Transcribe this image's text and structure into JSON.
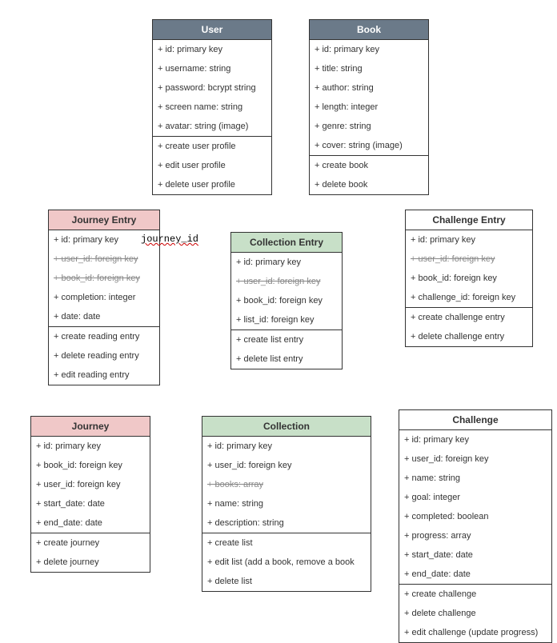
{
  "annotation": {
    "text": "journey_id"
  },
  "classes": {
    "user": {
      "title": "User",
      "attrs": [
        "+ id: primary key",
        "+ username: string",
        "+ password: bcrypt string",
        "+ screen name: string",
        "+ avatar: string (image)"
      ],
      "ops": [
        "+ create user profile",
        "+ edit user profile",
        "+ delete user profile"
      ]
    },
    "book": {
      "title": "Book",
      "attrs": [
        "+ id: primary key",
        "+ title: string",
        "+ author: string",
        "+ length: integer",
        "+ genre: string",
        "+ cover: string (image)"
      ],
      "ops": [
        "+ create book",
        "+ delete book"
      ]
    },
    "journeyEntry": {
      "title": "Journey Entry",
      "attrs": [
        {
          "text": "+ id: primary key",
          "strike": false
        },
        {
          "text": "+ user_id: foreign key",
          "strike": true
        },
        {
          "text": "+ book_id: foreign key",
          "strike": true
        },
        {
          "text": "+ completion: integer",
          "strike": false
        },
        {
          "text": "+ date: date",
          "strike": false
        }
      ],
      "ops": [
        "+ create reading entry",
        "+ delete reading entry",
        "+ edit reading entry"
      ]
    },
    "collectionEntry": {
      "title": "Collection Entry",
      "attrs": [
        {
          "text": "+ id: primary key",
          "strike": false
        },
        {
          "text": "+ user_id: foreign key",
          "strike": true
        },
        {
          "text": "+ book_id: foreign key",
          "strike": false
        },
        {
          "text": "+ list_id: foreign key",
          "strike": false
        }
      ],
      "ops": [
        "+ create list entry",
        "+ delete list entry"
      ]
    },
    "challengeEntry": {
      "title": "Challenge Entry",
      "attrs": [
        {
          "text": "+ id: primary key",
          "strike": false
        },
        {
          "text": "+ user_id: foreign key",
          "strike": true
        },
        {
          "text": "+ book_id: foreign key",
          "strike": false
        },
        {
          "text": "+ challenge_id: foreign key",
          "strike": false
        }
      ],
      "ops": [
        "+ create challenge entry",
        "+ delete challenge entry"
      ]
    },
    "journey": {
      "title": "Journey",
      "attrs": [
        "+ id: primary key",
        "+ book_id: foreign key",
        "+ user_id: foreign key",
        "+ start_date: date",
        "+ end_date: date"
      ],
      "ops": [
        "+ create journey",
        "+ delete journey"
      ]
    },
    "collection": {
      "title": "Collection",
      "attrs": [
        {
          "text": "+ id: primary key",
          "strike": false
        },
        {
          "text": "+ user_id: foreign key",
          "strike": false
        },
        {
          "text": "+ books: array",
          "strike": true
        },
        {
          "text": "+ name: string",
          "strike": false
        },
        {
          "text": "+ description: string",
          "strike": false
        }
      ],
      "ops": [
        "+ create list",
        "+ edit list (add a book, remove a book",
        "+ delete list"
      ]
    },
    "challenge": {
      "title": "Challenge",
      "attrs": [
        "+ id: primary key",
        "+ user_id: foreign key",
        "+ name: string",
        "+ goal: integer",
        "+ completed: boolean",
        "+ progress: array",
        "+ start_date: date",
        "+ end_date: date"
      ],
      "ops": [
        "+ create challenge",
        "+ delete challenge",
        "+ edit challenge (update progress)"
      ]
    }
  }
}
